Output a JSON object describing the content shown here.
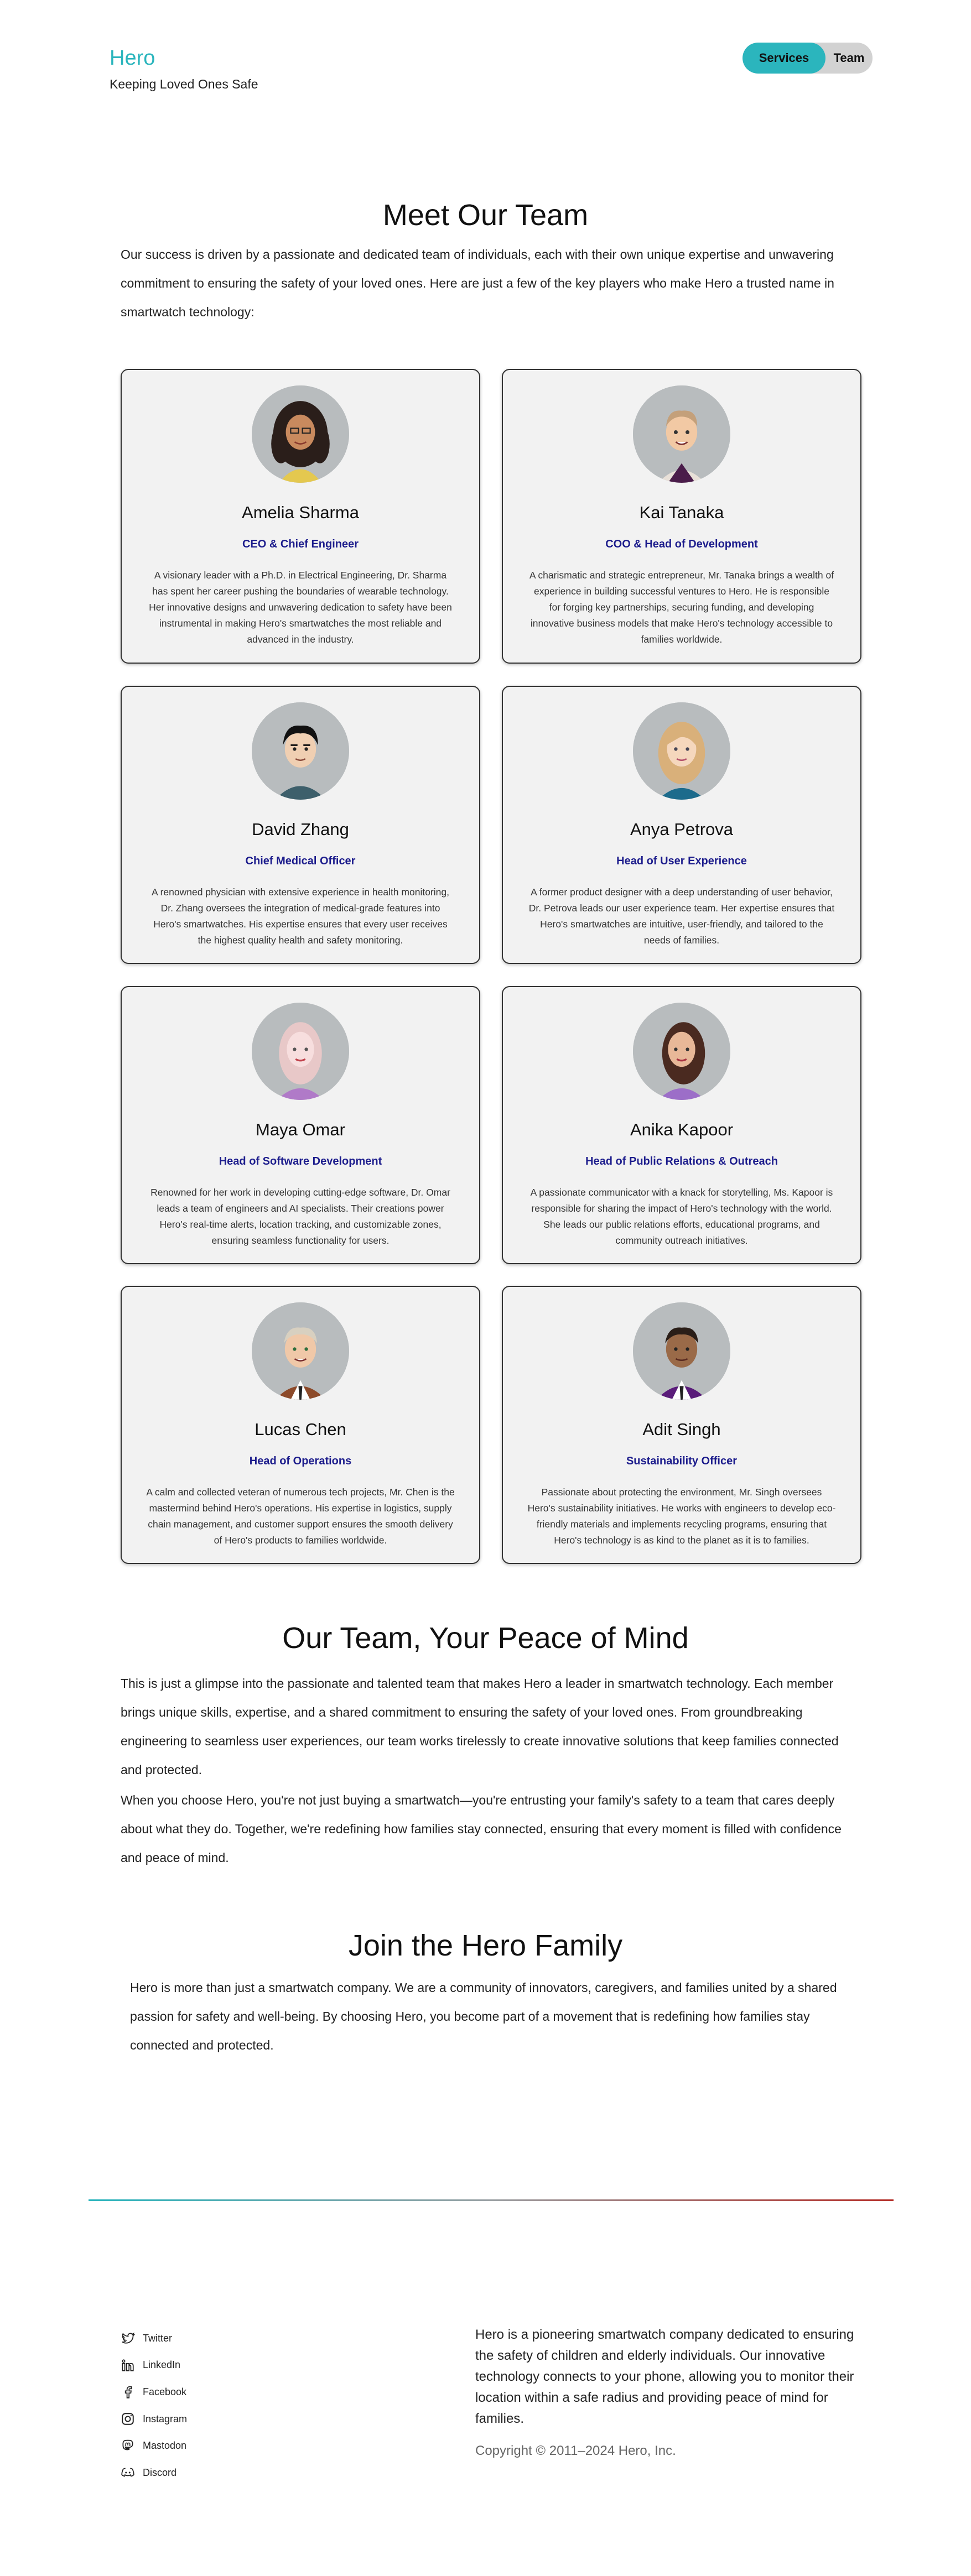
{
  "header": {
    "brand": "Hero",
    "tagline": "Keeping Loved Ones Safe",
    "nav": {
      "services": "Services",
      "team": "Team"
    }
  },
  "meet": {
    "title": "Meet Our Team",
    "intro": "Our success is driven by a passionate and dedicated team of individuals, each with their own unique expertise and unwavering commitment to ensuring the safety of your loved ones. Here are just a few of the key players who make Hero a trusted name in smartwatch technology:"
  },
  "team": [
    {
      "name": "Amelia Sharma",
      "role": "CEO & Chief Engineer",
      "bio": "A visionary leader with a Ph.D. in Electrical Engineering, Dr. Sharma has spent her career pushing the boundaries of wearable technology. Her innovative designs and unwavering dedication to safety have been instrumental in making Hero's smartwatches the most reliable and advanced in the industry."
    },
    {
      "name": "Kai Tanaka",
      "role": "COO & Head of Development",
      "bio": "A charismatic and strategic entrepreneur, Mr. Tanaka brings a wealth of experience in building successful ventures to Hero. He is responsible for forging key partnerships, securing funding, and developing innovative business models that make Hero's technology accessible to families worldwide."
    },
    {
      "name": "David Zhang",
      "role": "Chief Medical Officer",
      "bio": "A renowned physician with extensive experience in health monitoring, Dr. Zhang oversees the integration of medical-grade features into Hero's smartwatches. His expertise ensures that every user receives the highest quality health and safety monitoring."
    },
    {
      "name": "Anya Petrova",
      "role": "Head of User Experience",
      "bio": "A former product designer with a deep understanding of user behavior, Dr. Petrova leads our user experience team. Her expertise ensures that Hero's smartwatches are intuitive, user-friendly, and tailored to the needs of families."
    },
    {
      "name": "Maya Omar",
      "role": "Head of Software Development",
      "bio": "Renowned for her work in developing cutting-edge software, Dr. Omar leads a team of engineers and AI specialists. Their creations power Hero's real-time alerts, location tracking, and customizable zones, ensuring seamless functionality for users."
    },
    {
      "name": "Anika Kapoor",
      "role": "Head of Public Relations & Outreach",
      "bio": "A passionate communicator with a knack for storytelling, Ms. Kapoor is responsible for sharing the impact of Hero's technology with the world. She leads our public relations efforts, educational programs, and community outreach initiatives."
    },
    {
      "name": "Lucas Chen",
      "role": "Head of Operations",
      "bio": "A calm and collected veteran of numerous tech projects, Mr. Chen is the mastermind behind Hero's operations. His expertise in logistics, supply chain management, and customer support ensures the smooth delivery of Hero's products to families worldwide."
    },
    {
      "name": "Adit Singh",
      "role": "Sustainability Officer",
      "bio": "Passionate about protecting the environment, Mr. Singh oversees Hero's sustainability initiatives. He works with engineers to develop eco-friendly materials and implements recycling programs, ensuring that Hero's technology is as kind to the planet as it is to families."
    }
  ],
  "peace": {
    "title": "Our Team, Your Peace of Mind",
    "p1": "This is just a glimpse into the passionate and talented team that makes Hero a leader in smartwatch technology. Each member brings unique skills, expertise, and a shared commitment to ensuring the safety of your loved ones. From groundbreaking engineering to seamless user experiences, our team works tirelessly to create innovative solutions that keep families connected and protected.",
    "p2": "When you choose Hero, you're not just buying a smartwatch—you're entrusting your family's safety to a team that cares deeply about what they do. Together, we're redefining how families stay connected, ensuring that every moment is filled with confidence and peace of mind."
  },
  "join": {
    "title": "Join the Hero Family",
    "text": "Hero is more than just a smartwatch company. We are a community of innovators, caregivers, and families united by a shared passion for safety and well-being. By choosing Hero, you become part of a movement that is redefining how families stay connected and protected."
  },
  "footer": {
    "social": [
      {
        "label": "Twitter",
        "icon": "twitter-icon"
      },
      {
        "label": "LinkedIn",
        "icon": "linkedin-icon"
      },
      {
        "label": "Facebook",
        "icon": "facebook-icon"
      },
      {
        "label": "Instagram",
        "icon": "instagram-icon"
      },
      {
        "label": "Mastodon",
        "icon": "mastodon-icon"
      },
      {
        "label": "Discord",
        "icon": "discord-icon"
      }
    ],
    "about": "Hero is a pioneering smartwatch company dedicated to ensuring the safety of children and elderly individuals. Our innovative technology connects to your phone, allowing you to monitor their location within a safe radius and providing peace of mind for families.",
    "copyright": "Copyright © 2011–2024 Hero, Inc."
  },
  "colors": {
    "brand": "#2bb5bd",
    "role": "#1c1c8c",
    "accent_red": "#b5302a"
  }
}
